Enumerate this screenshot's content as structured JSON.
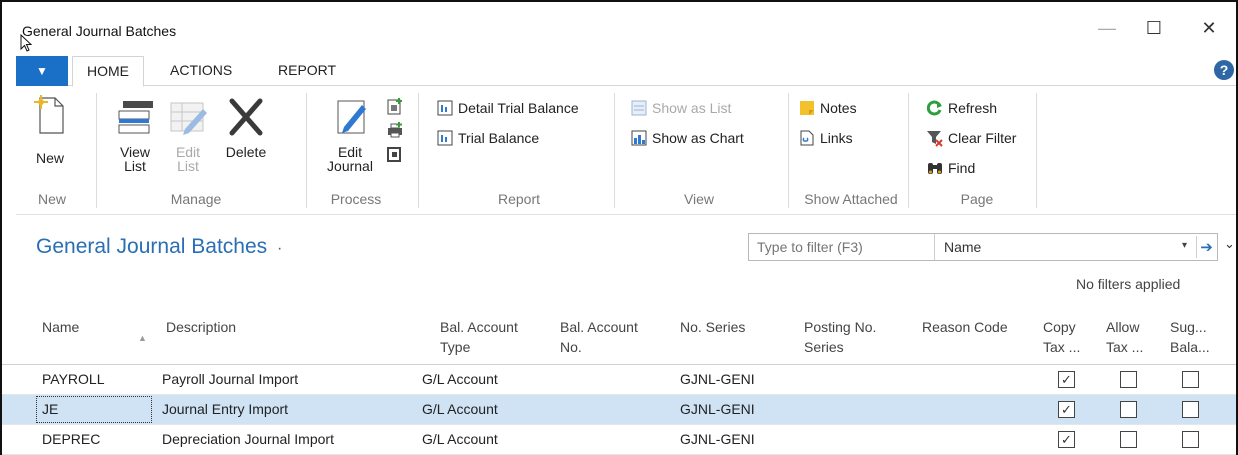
{
  "window": {
    "title": "General Journal Batches",
    "minimize_glyph": "—",
    "maximize_glyph": "☐",
    "close_glyph": "✕"
  },
  "ribbon_tabs": {
    "file_glyph": "▼",
    "items": [
      "HOME",
      "ACTIONS",
      "REPORT"
    ],
    "active": "HOME",
    "help_glyph": "?"
  },
  "ribbon": {
    "groups": {
      "new": "New",
      "manage": "Manage",
      "process": "Process",
      "report": "Report",
      "view": "View",
      "show_attached": "Show Attached",
      "page": "Page"
    },
    "new_button": "New",
    "view_list_button": "View\nList",
    "edit_list_button": "Edit\nList",
    "delete_button": "Delete",
    "edit_journal_button": "Edit\nJournal",
    "detail_trial_balance": "Detail Trial Balance",
    "trial_balance": "Trial Balance",
    "show_as_list": "Show as List",
    "show_as_chart": "Show as Chart",
    "notes": "Notes",
    "links": "Links",
    "refresh": "Refresh",
    "clear_filter": "Clear Filter",
    "find": "Find"
  },
  "page": {
    "title": "General Journal Batches",
    "title_caret": "·",
    "filter_placeholder": "Type to filter (F3)",
    "filter_field": "Name",
    "filter_caret": "▾",
    "filter_go": "➔",
    "expand_chevron": "⌄",
    "no_filters": "No filters applied"
  },
  "table": {
    "columns": {
      "name": "Name",
      "description": "Description",
      "bal_account_type": "Bal. Account\nType",
      "bal_account_no": "Bal. Account\nNo.",
      "no_series": "No. Series",
      "posting_no_series": "Posting No.\nSeries",
      "reason_code": "Reason Code",
      "copy_tax": "Copy\nTax ...",
      "allow_tax": "Allow\nTax ...",
      "suggest_balance": "Sug...\nBala..."
    },
    "sort_indicator": "▲",
    "rows": [
      {
        "name": "PAYROLL",
        "description": "Payroll Journal Import",
        "bal_account_type": "G/L Account",
        "bal_account_no": "",
        "no_series": "GJNL-GENI",
        "posting_no_series": "",
        "reason_code": "",
        "copy_tax": true,
        "allow_tax": false,
        "suggest_balance": false
      },
      {
        "name": "JE",
        "description": "Journal Entry Import",
        "bal_account_type": "G/L Account",
        "bal_account_no": "",
        "no_series": "GJNL-GENI",
        "posting_no_series": "",
        "reason_code": "",
        "copy_tax": true,
        "allow_tax": false,
        "suggest_balance": false
      },
      {
        "name": "DEPREC",
        "description": "Depreciation Journal Import",
        "bal_account_type": "G/L Account",
        "bal_account_no": "",
        "no_series": "GJNL-GENI",
        "posting_no_series": "",
        "reason_code": "",
        "copy_tax": true,
        "allow_tax": false,
        "suggest_balance": false
      }
    ],
    "selected_row": 1,
    "check_glyph": "✓"
  },
  "colors": {
    "accent": "#2a6eb5",
    "file_tab": "#1a6fc7",
    "selected_row": "#cfe3f5"
  }
}
